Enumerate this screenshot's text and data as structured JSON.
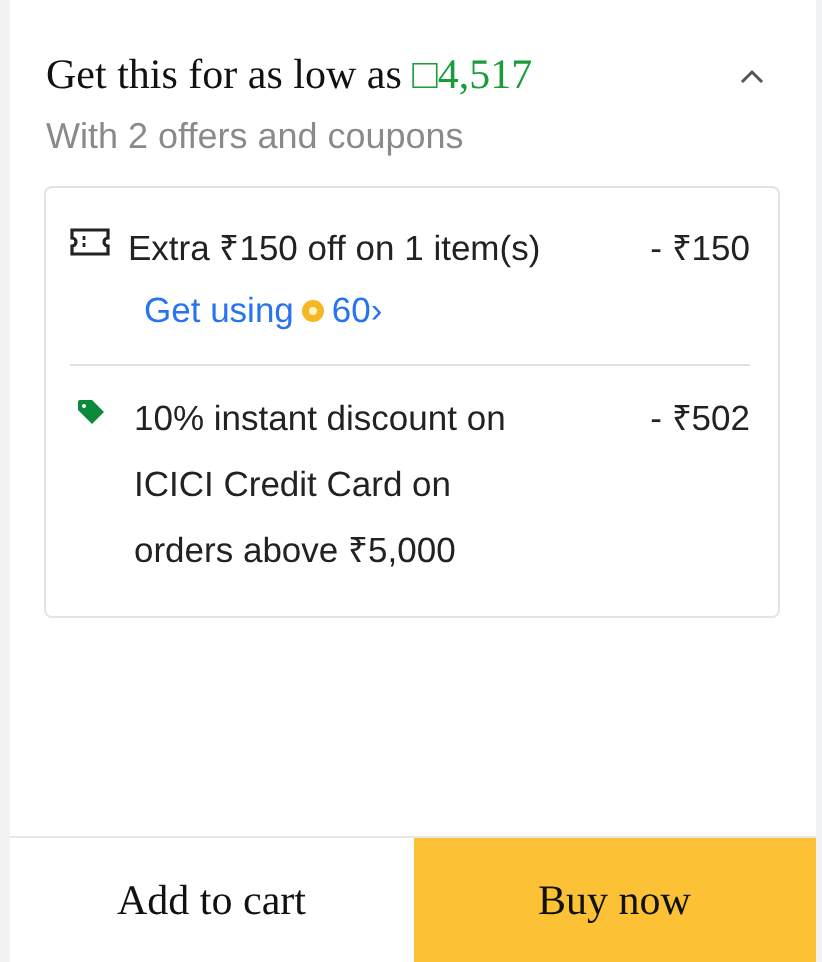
{
  "header": {
    "title": "Get this for as low as",
    "price": "□4,517",
    "expanded": true
  },
  "subtitle": "With 2 offers and coupons",
  "offers": [
    {
      "kind": "coupon",
      "text": "Extra ₹150 off on 1 item(s)",
      "amount": "- ₹150",
      "link": {
        "label": "Get using",
        "coins": "60›"
      }
    },
    {
      "kind": "bank",
      "text": "10% instant discount on ICICI Credit Card on orders above ₹5,000",
      "amount": "- ₹502"
    }
  ],
  "buttons": [
    {
      "label": "Add to cart",
      "kind": "secondary"
    },
    {
      "label": "Buy now",
      "kind": "primary"
    }
  ]
}
